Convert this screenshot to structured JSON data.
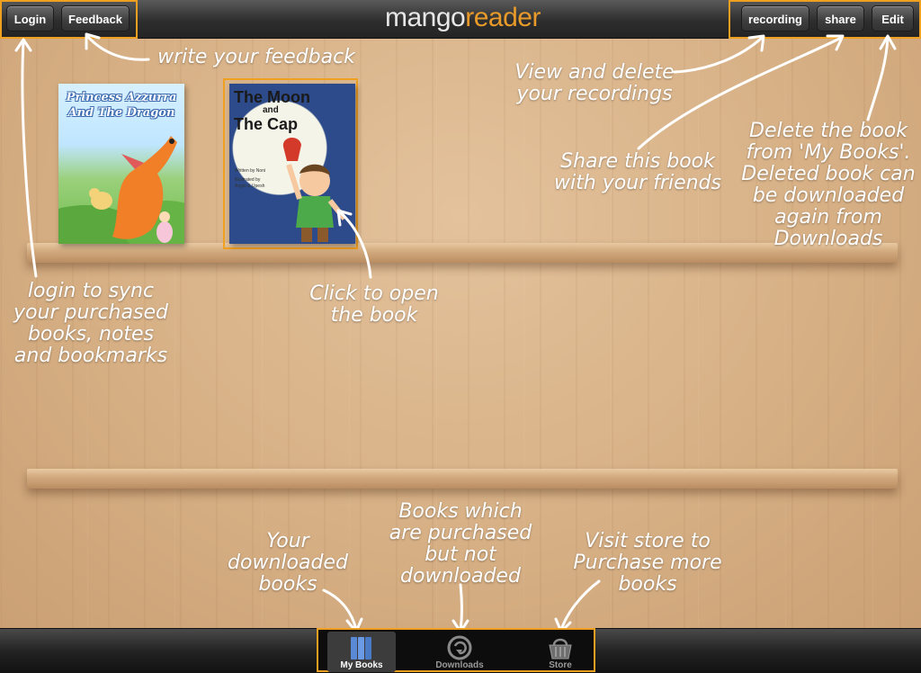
{
  "header": {
    "logo_part1": "mango",
    "logo_part2": "reader",
    "login_label": "Login",
    "feedback_label": "Feedback",
    "recording_label": "recording",
    "share_label": "share",
    "edit_label": "Edit"
  },
  "books": [
    {
      "title": "Princess Azzurra And The Dragon"
    },
    {
      "title_line1": "The Moon",
      "title_and": "and",
      "title_line2": "The Cap",
      "credit_written": "Written by Noni",
      "credit_illustrated": "Illustrated by",
      "credit_artists": "Angie & Upesh"
    }
  ],
  "annotations": {
    "feedback": "write your feedback",
    "recordings": "View and delete\nyour recordings",
    "share": "Share this book\nwith your friends",
    "edit": "Delete the book\nfrom 'My Books'.\nDeleted book can\nbe downloaded\nagain from\nDownloads",
    "login": "login to sync\nyour purchased\nbooks, notes\nand bookmarks",
    "open_book": "Click to open\nthe book",
    "my_books": "Your\ndownloaded\nbooks",
    "downloads": "Books which\nare purchased\nbut not\ndownloaded",
    "store": "Visit store to\nPurchase more\nbooks"
  },
  "tabs": [
    {
      "label": "My Books",
      "icon": "books-icon",
      "active": true
    },
    {
      "label": "Downloads",
      "icon": "download-icon",
      "active": false
    },
    {
      "label": "Store",
      "icon": "basket-icon",
      "active": false
    }
  ],
  "colors": {
    "highlight": "#f0a020",
    "logo_accent": "#e89a2a"
  }
}
